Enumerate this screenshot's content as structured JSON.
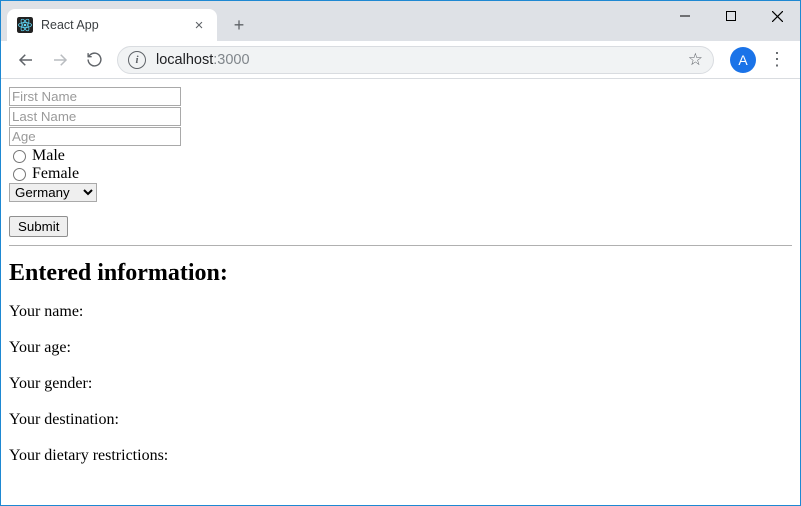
{
  "window": {
    "tab_title": "React App",
    "favicon": "react-logo"
  },
  "toolbar": {
    "url_host": "localhost",
    "url_port": ":3000",
    "avatar_letter": "A"
  },
  "form": {
    "first_name_placeholder": "First Name",
    "first_name_value": "",
    "last_name_placeholder": "Last Name",
    "last_name_value": "",
    "age_placeholder": "Age",
    "age_value": "",
    "gender_options": {
      "male": "Male",
      "female": "Female"
    },
    "destination_selected": "Germany",
    "submit_label": "Submit"
  },
  "output": {
    "heading": "Entered information:",
    "name_label": "Your name:",
    "name_value": "",
    "age_label": "Your age:",
    "age_value": "",
    "gender_label": "Your gender:",
    "gender_value": "",
    "destination_label": "Your destination:",
    "destination_value": "",
    "diet_label": "Your dietary restrictions:",
    "diet_value": ""
  }
}
